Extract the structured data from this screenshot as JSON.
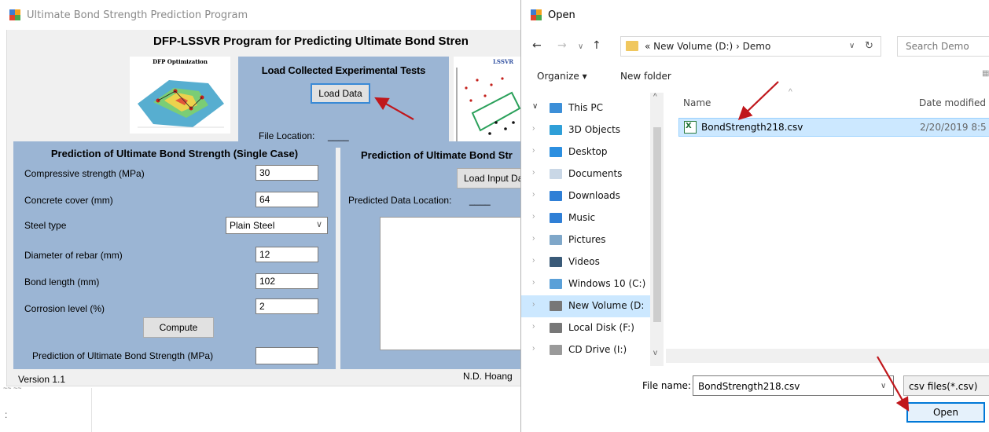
{
  "app": {
    "title": "Ultimate Bond Strength Prediction Program",
    "heading": "DFP-LSSVR Program for Predicting Ultimate Bond Stren",
    "dfp_image_label": "DFP Optimization",
    "lssvr_image_label": "LSSVR",
    "load_panel": {
      "title": "Load Collected Experimental Tests",
      "load_button": "Load Data",
      "file_location_label": "File Location:",
      "file_location_value": "____"
    },
    "single_case": {
      "title": "Prediction of Ultimate Bond Strength (Single Case)",
      "fields": [
        {
          "label": "Compressive strength (MPa)",
          "value": "30"
        },
        {
          "label": "Concrete cover (mm)",
          "value": "64"
        },
        {
          "label": "Steel type",
          "value": "Plain Steel"
        },
        {
          "label": "Diameter of rebar (mm)",
          "value": "12"
        },
        {
          "label": "Bond length (mm)",
          "value": "102"
        },
        {
          "label": "Corrosion level (%)",
          "value": "2"
        }
      ],
      "compute_button": "Compute",
      "output_label": "Prediction of Ultimate Bond Strength (MPa)",
      "output_value": ""
    },
    "multi_case": {
      "title": "Prediction of Ultimate Bond Str",
      "load_button": "Load Input Da",
      "predicted_location_label": "Predicted Data Location:",
      "predicted_location_value": "____"
    },
    "version": "Version 1.1",
    "author": "N.D. Hoang",
    "bottom_glyph": ":"
  },
  "dialog": {
    "title": "Open",
    "address_path": "« New Volume (D:)  ›  Demo",
    "search_placeholder": "Search Demo",
    "toolbar": {
      "organize": "Organize ▾",
      "new_folder": "New folder"
    },
    "nav_items": [
      {
        "label": "This PC",
        "icon_color": "#3c8fd8",
        "arrow": "∨",
        "open": true
      },
      {
        "label": "3D Objects",
        "icon_color": "#2f9fd8",
        "arrow": "›",
        "open": false
      },
      {
        "label": "Desktop",
        "icon_color": "#2c8fe0",
        "arrow": "›",
        "open": false
      },
      {
        "label": "Documents",
        "icon_color": "#c9d7e6",
        "arrow": "›",
        "open": false
      },
      {
        "label": "Downloads",
        "icon_color": "#2f7fd6",
        "arrow": "›",
        "open": false
      },
      {
        "label": "Music",
        "icon_color": "#2f7fd6",
        "arrow": "›",
        "open": false
      },
      {
        "label": "Pictures",
        "icon_color": "#7fa7c9",
        "arrow": "›",
        "open": false
      },
      {
        "label": "Videos",
        "icon_color": "#3a5a78",
        "arrow": "›",
        "open": false
      },
      {
        "label": "Windows 10 (C:)",
        "icon_color": "#5aa0d8",
        "arrow": "›",
        "open": false
      },
      {
        "label": "New Volume (D:",
        "icon_color": "#777777",
        "arrow": "›",
        "open": false
      },
      {
        "label": "Local Disk (F:)",
        "icon_color": "#777777",
        "arrow": "›",
        "open": false
      },
      {
        "label": "CD Drive (I:)",
        "icon_color": "#9a9a9a",
        "arrow": "›",
        "open": false
      }
    ],
    "columns": {
      "name": "Name",
      "date": "Date modified"
    },
    "files": [
      {
        "name": "BondStrength218.csv",
        "date": "2/20/2019 8:5"
      }
    ],
    "filename_label": "File name:",
    "filename_value": "BondStrength218.csv",
    "filetype_value": "csv files(*.csv)",
    "open_button": "Open"
  },
  "colors": {
    "panel_blue": "#9bb5d4",
    "selection": "#cce8ff",
    "accent": "#0078d7",
    "arrow_red": "#c0171c"
  }
}
